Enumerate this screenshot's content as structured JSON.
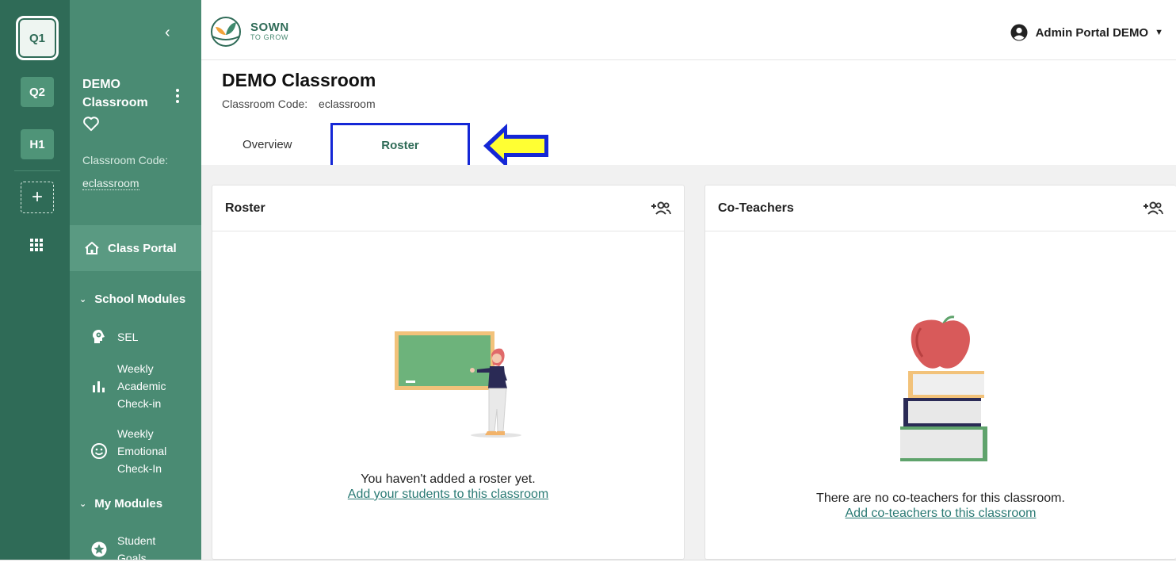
{
  "rail": {
    "items": [
      {
        "label": "Q1",
        "active": true
      },
      {
        "label": "Q2",
        "active": false
      },
      {
        "label": "H1",
        "active": false
      }
    ],
    "add_label": "+"
  },
  "sidebar": {
    "collapse_icon": "chevron-left-icon",
    "classroom_name": "DEMO Classroom",
    "code_label": "Classroom Code:",
    "code_value": "eclassroom",
    "portal_label": "Class Portal",
    "sections": [
      {
        "label": "School Modules",
        "items": [
          {
            "label": "SEL",
            "icon": "brain-gear-icon"
          },
          {
            "label": "Weekly Academic Check-in",
            "icon": "bar-chart-icon"
          },
          {
            "label": "Weekly Emotional Check-In",
            "icon": "smiley-icon"
          }
        ]
      },
      {
        "label": "My Modules",
        "items": [
          {
            "label": "Student Goals",
            "icon": "star-badge-icon"
          }
        ]
      }
    ]
  },
  "header": {
    "logo_big": "SOWN",
    "logo_small": "TO GROW",
    "user_name": "Admin Portal DEMO"
  },
  "page": {
    "title": "DEMO Classroom",
    "code_label": "Classroom Code:",
    "code_value": "eclassroom",
    "tabs": [
      {
        "label": "Overview",
        "active": false
      },
      {
        "label": "Roster",
        "active": true
      }
    ]
  },
  "roster_card": {
    "title": "Roster",
    "empty_text": "You haven't added a roster yet.",
    "empty_link": "Add your students to this classroom"
  },
  "coteachers_card": {
    "title": "Co-Teachers",
    "empty_text": "There are no co-teachers for this classroom.",
    "empty_link": "Add co-teachers to this classroom"
  },
  "colors": {
    "rail": "#2f6b57",
    "sidebar": "#4a8b73",
    "accent": "#2f6b57",
    "highlight_box": "#1427d6",
    "arrow_fill": "#ffff33"
  }
}
